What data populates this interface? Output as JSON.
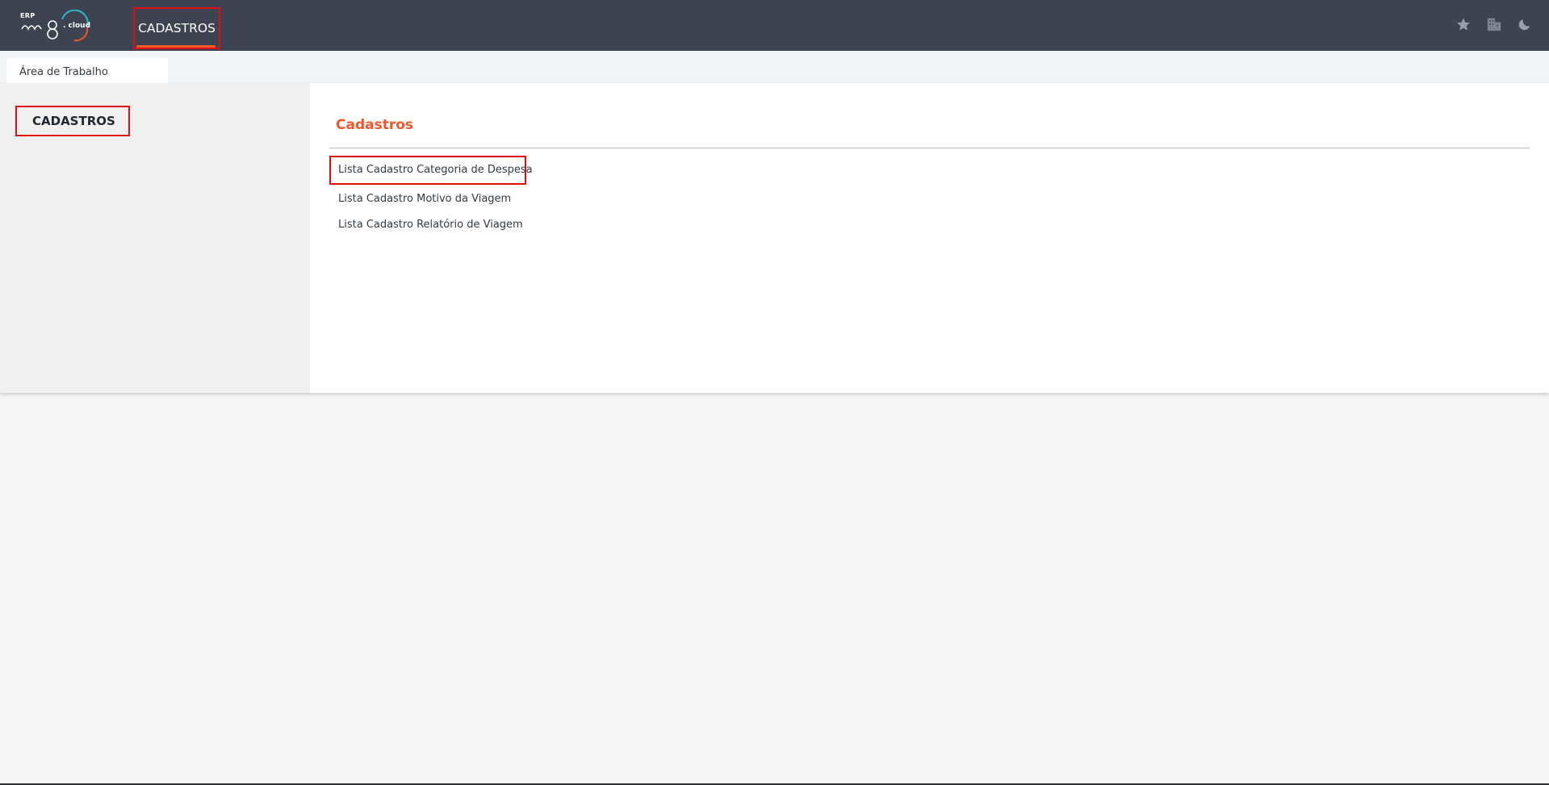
{
  "topbar": {
    "logo": {
      "erp": "ERP",
      "brand": "m8",
      "suffix": ". cloud"
    },
    "nav_item": "CADASTROS",
    "icons": [
      "star-icon",
      "building-icon",
      "moon-icon"
    ]
  },
  "tabs": [
    {
      "label": "Área de Trabalho"
    }
  ],
  "sidebar": {
    "items": [
      {
        "label": "CADASTROS"
      }
    ]
  },
  "main": {
    "section_title": "Cadastros",
    "links": [
      {
        "label": "Lista Cadastro Categoria de Despesa"
      },
      {
        "label": "Lista Cadastro Motivo da Viagem"
      },
      {
        "label": "Lista Cadastro Relatório de Viagem"
      }
    ]
  },
  "colors": {
    "topbar": "#3d4350",
    "accent": "#f0572a",
    "highlight_border": "#e01010"
  }
}
